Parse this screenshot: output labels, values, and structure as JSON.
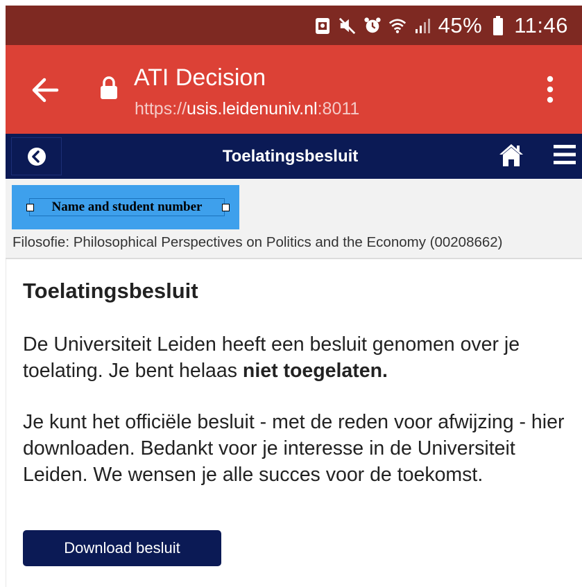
{
  "status_bar": {
    "battery_percent": "45%",
    "time": "11:46",
    "icons": [
      "photo-icon",
      "mute-icon",
      "alarm-icon",
      "wifi-icon",
      "signal-icon",
      "battery-icon"
    ]
  },
  "browser": {
    "title": "ATI Decision",
    "url_scheme": "https://",
    "url_host": "usis.leidenuniv.nl",
    "url_port": ":8011"
  },
  "navbar": {
    "title": "Toelatingsbesluit"
  },
  "info": {
    "redaction_label": "Name and student number",
    "program": "Filosofie: Philosophical Perspectives on Politics and the Economy (00208662)"
  },
  "content": {
    "heading": "Toelatingsbesluit",
    "paragraph1_text": "De Universiteit Leiden heeft een besluit genomen over je toelating. Je bent helaas ",
    "paragraph1_bold": "niet toegelaten.",
    "paragraph2": "Je kunt het officiële besluit - met de reden voor afwijzing - hier downloaden. Bedankt voor je interesse in de Universiteit Leiden. We wensen je alle succes voor de toekomst.",
    "download_label": "Download besluit"
  },
  "colors": {
    "status_bar": "#7e2922",
    "toolbar": "#dc4136",
    "navy": "#0b1a55",
    "redaction": "#3ea0ec"
  }
}
